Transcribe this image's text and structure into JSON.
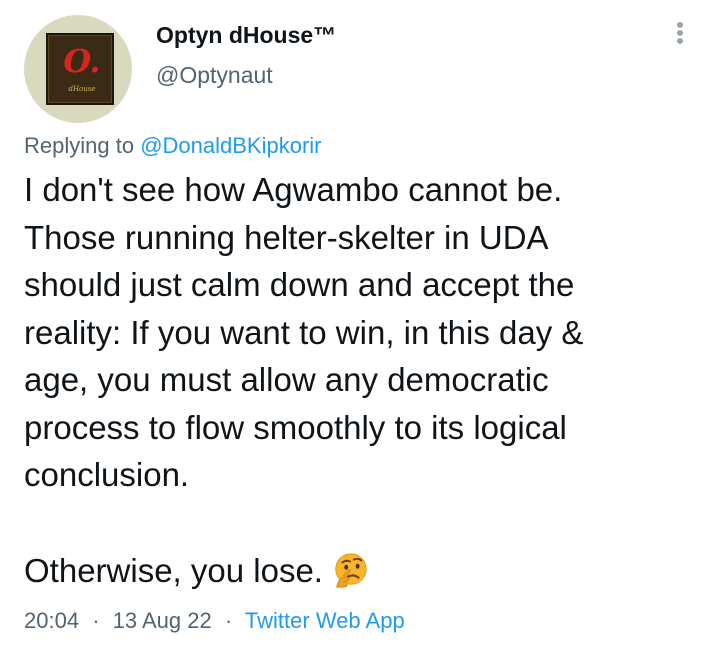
{
  "author": {
    "display_name": "Optyn dHouse™",
    "handle": "@Optynaut",
    "avatar_logo_text": "O.",
    "avatar_caption": "dHouse"
  },
  "reply": {
    "prefix": "Replying to",
    "mention": "@DonaldBKipkorir"
  },
  "tweet": {
    "paragraph_1": "I don't see how Agwambo cannot be.\nThose running helter-skelter in UDA\nshould just calm down and accept the\nreality: If you want to win, in this day &\nage, you must allow any democratic\nprocess to flow smoothly to its logical\nconclusion.",
    "paragraph_2": "Otherwise, you lose.",
    "emoji_icon": "thinking-face-icon"
  },
  "meta": {
    "time": "20:04",
    "date": "13 Aug 22",
    "separator": "·",
    "source": "Twitter Web App"
  },
  "colors": {
    "text_primary": "#0f1419",
    "text_secondary": "#536471",
    "link": "#1d9bf0",
    "avatar_bg": "#d8d9bf"
  }
}
